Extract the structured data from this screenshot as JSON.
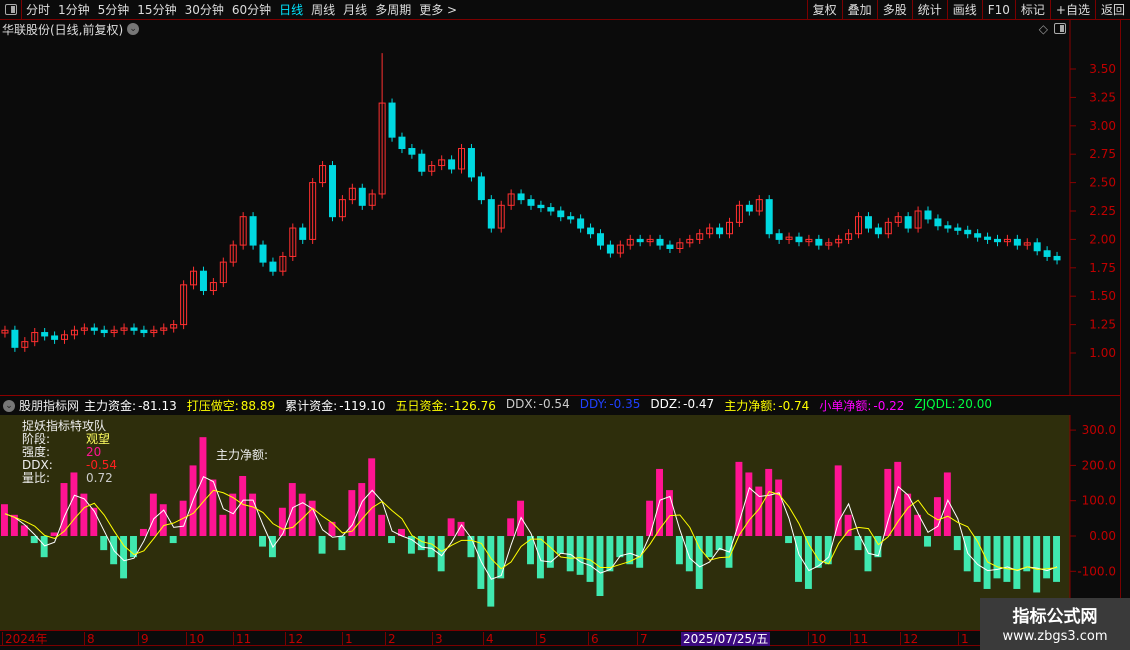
{
  "toolbar": {
    "periods": [
      "分时",
      "1分钟",
      "5分钟",
      "15分钟",
      "30分钟",
      "60分钟",
      "日线",
      "周线",
      "月线",
      "多周期",
      "更多 >"
    ],
    "active": "日线",
    "right_buttons": [
      "复权",
      "叠加",
      "多股",
      "统计",
      "画线",
      "F10",
      "标记",
      "+自选",
      "返回"
    ]
  },
  "title": "华联股份(日线,前复权)",
  "colors": {
    "up": "#ff3030",
    "down": "#00d8e0",
    "pos_bar": "#ff1493",
    "neg_bar": "#40e8b0",
    "axis": "#c00000",
    "indicator_bg": "#2e2e0c"
  },
  "price_axis": {
    "ticks": [
      "3.50",
      "3.25",
      "3.00",
      "2.75",
      "2.50",
      "2.25",
      "2.00",
      "1.75",
      "1.50",
      "1.25",
      "1.00"
    ]
  },
  "indicator_header": {
    "name": "股朋指标网",
    "items": [
      {
        "label": "主力资金:",
        "value": "-81.13",
        "color": "#ffffff"
      },
      {
        "label": "打压做空:",
        "value": "88.89",
        "color": "#ffff00"
      },
      {
        "label": "累计资金:",
        "value": "-119.10",
        "color": "#ffffff"
      },
      {
        "label": "五日资金:",
        "value": "-126.76",
        "color": "#ffff00"
      },
      {
        "label": "DDX:",
        "value": "-0.54",
        "color": "#cccccc"
      },
      {
        "label": "DDY:",
        "value": "-0.35",
        "color": "#2040ff"
      },
      {
        "label": "DDZ:",
        "value": "-0.47",
        "color": "#ffffff"
      },
      {
        "label": "主力净额:",
        "value": "-0.74",
        "color": "#ffff00"
      },
      {
        "label": "小单净额:",
        "value": "-0.22",
        "color": "#ff00ff"
      },
      {
        "label": "ZJQDL:",
        "value": "20.00",
        "color": "#00ff40"
      }
    ]
  },
  "indicator_panel": {
    "title": "捉妖指标特攻队",
    "stage_label": "阶段:",
    "stage_value": "观望",
    "strength_label": "强度:",
    "strength_value": "20",
    "ddx_label": "DDX:",
    "ddx_value": "-0.54",
    "ratio_label": "量比:",
    "ratio_value": "0.72",
    "net_label": "主力净额:"
  },
  "indicator_axis": {
    "ticks": [
      "300.0",
      "200.0",
      "100.0",
      "0.00",
      "-100.0"
    ]
  },
  "date_axis": {
    "labels": [
      "2024年",
      "8",
      "9",
      "10",
      "11",
      "12",
      "1",
      "2",
      "3",
      "4",
      "5",
      "6",
      "7",
      "2025/07/25/五",
      "10",
      "11",
      "12",
      "1"
    ]
  },
  "watermark": {
    "line1": "指标公式网",
    "line2": "www.zbgs3.com"
  },
  "chart_data": [
    {
      "type": "candlestick",
      "ylim": [
        0.8,
        3.75
      ],
      "yticks": [
        1.0,
        1.25,
        1.5,
        1.75,
        2.0,
        2.25,
        2.5,
        2.75,
        3.0,
        3.25,
        3.5
      ],
      "closes": [
        1.2,
        1.05,
        1.1,
        1.18,
        1.15,
        1.12,
        1.16,
        1.2,
        1.22,
        1.2,
        1.18,
        1.2,
        1.22,
        1.2,
        1.18,
        1.2,
        1.22,
        1.25,
        1.6,
        1.72,
        1.55,
        1.62,
        1.8,
        1.95,
        2.2,
        1.95,
        1.8,
        1.72,
        1.85,
        2.1,
        2.0,
        2.5,
        2.65,
        2.2,
        2.35,
        2.45,
        2.3,
        2.4,
        3.2,
        2.9,
        2.8,
        2.75,
        2.6,
        2.65,
        2.7,
        2.62,
        2.8,
        2.55,
        2.35,
        2.1,
        2.3,
        2.4,
        2.35,
        2.3,
        2.28,
        2.25,
        2.2,
        2.18,
        2.1,
        2.05,
        1.95,
        1.88,
        1.95,
        2.0,
        1.98,
        2.0,
        1.95,
        1.92,
        1.97,
        2.0,
        2.05,
        2.1,
        2.05,
        2.15,
        2.3,
        2.25,
        2.35,
        2.05,
        2.0,
        2.02,
        1.98,
        2.0,
        1.95,
        1.97,
        2.0,
        2.05,
        2.2,
        2.1,
        2.05,
        2.15,
        2.2,
        2.1,
        2.25,
        2.18,
        2.12,
        2.1,
        2.08,
        2.05,
        2.02,
        2.0,
        1.98,
        2.0,
        1.95,
        1.97,
        1.9,
        1.85,
        1.82
      ]
    },
    {
      "type": "bar",
      "name": "主力净额",
      "ylim": [
        -230,
        330
      ],
      "yticks": [
        300,
        200,
        100,
        0,
        -100
      ],
      "values": [
        90,
        60,
        30,
        -20,
        -60,
        10,
        150,
        180,
        120,
        80,
        -40,
        -80,
        -120,
        -60,
        20,
        120,
        90,
        -20,
        100,
        200,
        280,
        160,
        60,
        120,
        170,
        120,
        -30,
        -60,
        80,
        150,
        120,
        100,
        -50,
        40,
        -40,
        130,
        150,
        220,
        60,
        -20,
        20,
        -50,
        -40,
        -60,
        -100,
        50,
        40,
        -60,
        -150,
        -200,
        -120,
        50,
        100,
        -80,
        -120,
        -90,
        -50,
        -100,
        -110,
        -130,
        -170,
        -100,
        -60,
        -80,
        -90,
        100,
        190,
        130,
        -80,
        -100,
        -150,
        -60,
        -40,
        -90,
        210,
        180,
        140,
        190,
        160,
        -20,
        -130,
        -150,
        -90,
        -80,
        200,
        60,
        -40,
        -100,
        -60,
        190,
        210,
        120,
        60,
        -30,
        110,
        180,
        -40,
        -100,
        -130,
        -150,
        -120,
        -130,
        -150,
        -100,
        -160,
        -120,
        -130
      ]
    }
  ]
}
